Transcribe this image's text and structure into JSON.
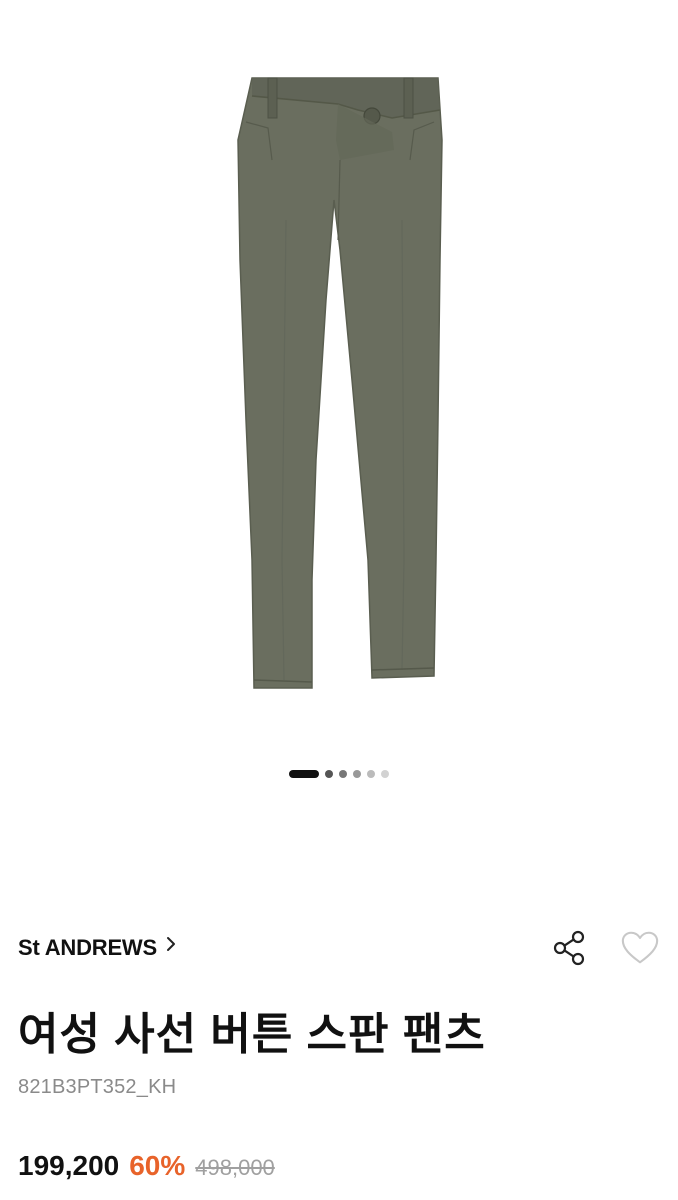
{
  "gallery": {
    "image": "khaki-pants-product-photo",
    "slide_count": 6,
    "active_index": 0
  },
  "product": {
    "brand": "St ANDREWS",
    "title": "여성 사선 버튼 스판 팬츠",
    "sku": "821B3PT352_KH",
    "price": "199,200",
    "discount": "60%",
    "original_price": "498,000"
  },
  "colors": {
    "fabric": "#6a6e5f",
    "accent": "#e8632a"
  },
  "icons": {
    "brand_link": "chevron-right-icon",
    "share": "share-icon",
    "wishlist": "heart-icon"
  }
}
